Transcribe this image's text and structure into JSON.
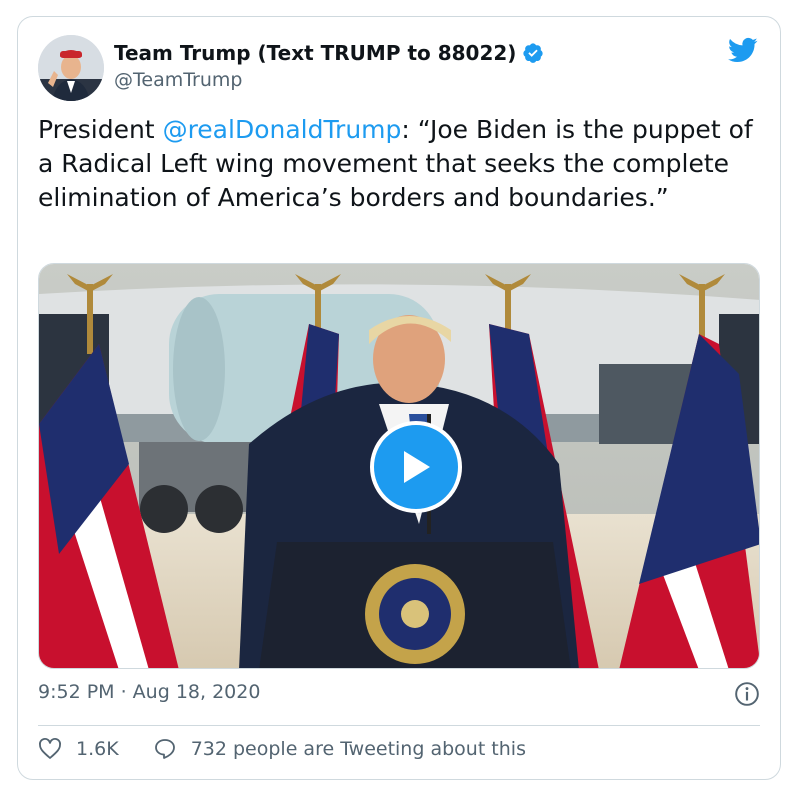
{
  "tweet": {
    "author": {
      "display_name": "Team Trump (Text TRUMP to 88022)",
      "handle": "@TeamTrump",
      "verified": true,
      "avatar_icon": "avatar-photo"
    },
    "text": {
      "prefix": "President ",
      "mention": "@realDonaldTrump",
      "body": ": “Joe Biden is the puppet of a Radical Left wing movement that seeks the complete elimination of America’s borders and boundaries.”"
    },
    "media": {
      "type": "video",
      "play_icon": "play-icon"
    },
    "timestamp": "9:52 PM · Aug 18, 2020",
    "stats": {
      "likes": "1.6K",
      "replies_text": "732 people are Tweeting about this"
    }
  },
  "icons": {
    "brand": "twitter-bird-icon",
    "info": "info-icon",
    "like": "heart-icon",
    "reply": "speech-bubble-icon"
  },
  "colors": {
    "accent": "#1d9bf0",
    "text": "#0f1419",
    "secondary": "#536471",
    "border": "#cfd9de"
  }
}
